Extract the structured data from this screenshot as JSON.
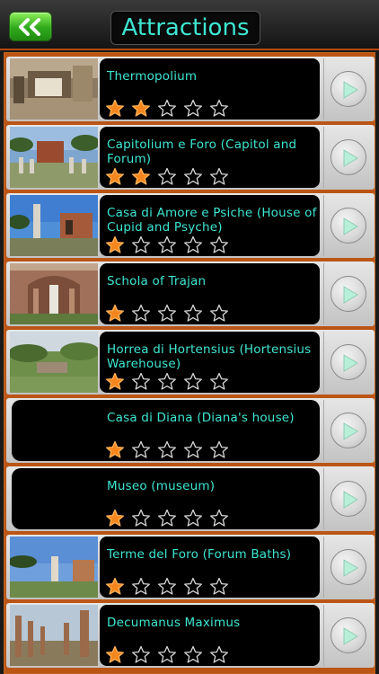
{
  "header": {
    "title": "Attractions",
    "back_icon": "double-chevron-left-icon"
  },
  "colors": {
    "accent_text": "#3ee6d2",
    "star_filled": "#f5861e",
    "back_button": "#2faa1c",
    "list_border": "#bb5515"
  },
  "attractions": [
    {
      "name": "Thermopolium",
      "rating": 2,
      "has_image": true
    },
    {
      "name": "Capitolium e Foro (Capitol and Forum)",
      "rating": 2,
      "has_image": true
    },
    {
      "name": "Casa di Amore e Psiche (House of Cupid and Psyche)",
      "rating": 1,
      "has_image": true
    },
    {
      "name": "Schola of Trajan",
      "rating": 1,
      "has_image": true
    },
    {
      "name": "Horrea di Hortensius (Hortensius Warehouse)",
      "rating": 1,
      "has_image": true
    },
    {
      "name": "Casa di Diana (Diana's house)",
      "rating": 1,
      "has_image": false
    },
    {
      "name": "Museo (museum)",
      "rating": 1,
      "has_image": false
    },
    {
      "name": "Terme del Foro (Forum Baths)",
      "rating": 1,
      "has_image": true
    },
    {
      "name": "Decumanus Maximus",
      "rating": 1,
      "has_image": true
    }
  ],
  "max_rating": 5,
  "row_button_icon": "play-arrow-icon"
}
